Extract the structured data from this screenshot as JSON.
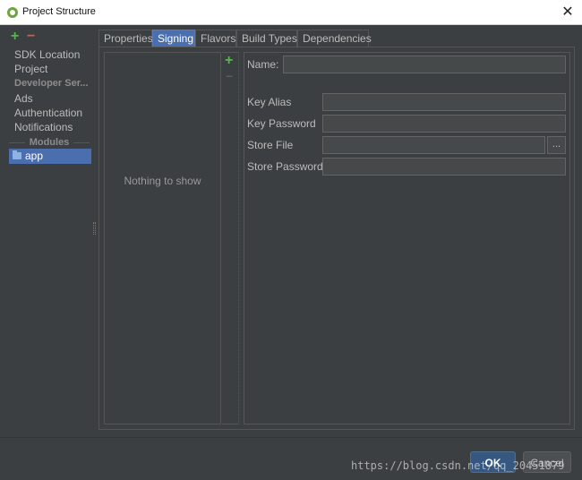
{
  "window": {
    "title": "Project Structure"
  },
  "sidebar": {
    "items": [
      {
        "label": "SDK Location"
      },
      {
        "label": "Project"
      }
    ],
    "developer_header": "Developer Ser...",
    "services": [
      {
        "label": "Ads"
      },
      {
        "label": "Authentication"
      },
      {
        "label": "Notifications"
      }
    ],
    "modules_header": "Modules",
    "modules": [
      {
        "label": "app"
      }
    ]
  },
  "tabs": [
    {
      "label": "Properties"
    },
    {
      "label": "Signing"
    },
    {
      "label": "Flavors"
    },
    {
      "label": "Build Types"
    },
    {
      "label": "Dependencies"
    }
  ],
  "active_tab": "Signing",
  "list": {
    "empty_text": "Nothing to show"
  },
  "form": {
    "name_label": "Name:",
    "name_value": "",
    "key_alias_label": "Key Alias",
    "key_alias_value": "",
    "key_password_label": "Key Password",
    "key_password_value": "",
    "store_file_label": "Store File",
    "store_file_value": "",
    "store_file_browse": "...",
    "store_password_label": "Store Password",
    "store_password_value": ""
  },
  "buttons": {
    "ok": "OK",
    "cancel": "Cancel"
  },
  "watermark": "https://blog.csdn.net/qq_20451879",
  "colors": {
    "background": "#3c3f41",
    "selection": "#4b6eaf",
    "add": "#54b948",
    "remove": "#d75a4a",
    "ok_button": "#365880"
  }
}
